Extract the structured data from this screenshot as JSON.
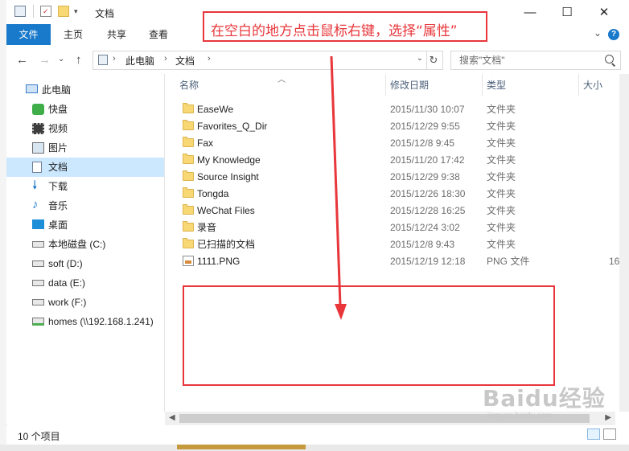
{
  "window": {
    "title": "文档",
    "buttons": {
      "minimize": "—",
      "maximize": "☐",
      "close": "✕"
    }
  },
  "ribbon": {
    "tabs": [
      "文件",
      "主页",
      "共享",
      "查看"
    ],
    "help": "?"
  },
  "address": {
    "crumbs": [
      "此电脑",
      "文档"
    ],
    "search_placeholder": "搜索\"文档\""
  },
  "nav": {
    "items": [
      {
        "label": "此电脑",
        "icon": "computer-icon"
      },
      {
        "label": "快盘",
        "icon": "kuaipan-icon"
      },
      {
        "label": "视频",
        "icon": "video-icon"
      },
      {
        "label": "图片",
        "icon": "pictures-icon"
      },
      {
        "label": "文档",
        "icon": "documents-icon",
        "selected": true
      },
      {
        "label": "下载",
        "icon": "download-icon"
      },
      {
        "label": "音乐",
        "icon": "music-icon"
      },
      {
        "label": "桌面",
        "icon": "desktop-icon"
      },
      {
        "label": "本地磁盘 (C:)",
        "icon": "windows-drive-icon"
      },
      {
        "label": "soft (D:)",
        "icon": "drive-icon"
      },
      {
        "label": "data (E:)",
        "icon": "drive-icon"
      },
      {
        "label": "work (F:)",
        "icon": "drive-icon"
      },
      {
        "label": "homes (\\\\192.168.1.241)",
        "icon": "network-drive-icon"
      }
    ]
  },
  "columns": {
    "name": "名称",
    "date": "修改日期",
    "type": "类型",
    "size": "大小"
  },
  "files": [
    {
      "name": "EaseWe",
      "date": "2015/11/30 10:07",
      "type": "文件夹",
      "size": ""
    },
    {
      "name": "Favorites_Q_Dir",
      "date": "2015/12/29 9:55",
      "type": "文件夹",
      "size": ""
    },
    {
      "name": "Fax",
      "date": "2015/12/8 9:45",
      "type": "文件夹",
      "size": ""
    },
    {
      "name": "My Knowledge",
      "date": "2015/11/20 17:42",
      "type": "文件夹",
      "size": ""
    },
    {
      "name": "Source Insight",
      "date": "2015/12/29 9:38",
      "type": "文件夹",
      "size": ""
    },
    {
      "name": "Tongda",
      "date": "2015/12/26 18:30",
      "type": "文件夹",
      "size": ""
    },
    {
      "name": "WeChat Files",
      "date": "2015/12/28 16:25",
      "type": "文件夹",
      "size": ""
    },
    {
      "name": "录音",
      "date": "2015/12/24 3:02",
      "type": "文件夹",
      "size": ""
    },
    {
      "name": "已扫描的文档",
      "date": "2015/12/8 9:43",
      "type": "文件夹",
      "size": ""
    },
    {
      "name": "1111.PNG",
      "date": "2015/12/19 12:18",
      "type": "PNG 文件",
      "size": "16"
    }
  ],
  "status": {
    "item_count": "10 个项目"
  },
  "annotation": {
    "text": "在空白的地方点击鼠标右键，选择“属性”",
    "color": "#e8363b"
  },
  "watermark": {
    "main": "Baidu经验",
    "sub": "jingyan.baidu.com"
  },
  "colors": {
    "accent": "#1979ca",
    "selection": "#cce8ff",
    "annotation": "#e8363b"
  }
}
